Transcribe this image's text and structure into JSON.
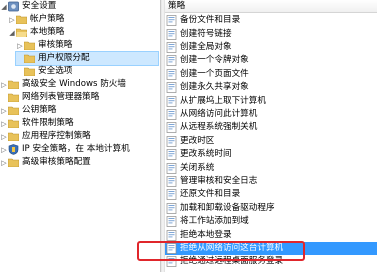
{
  "tree": {
    "items": [
      {
        "label": "安全设置",
        "arrow": "◢",
        "icon": "gear-icon"
      },
      {
        "label": "帐户策略",
        "arrow": "▷",
        "icon": "folder-icon"
      },
      {
        "label": "本地策略",
        "arrow": "◢",
        "icon": "folder-icon"
      },
      {
        "label": "审核策略",
        "arrow": "▷",
        "icon": "folder-icon"
      },
      {
        "label": "用户权限分配",
        "arrow": "",
        "icon": "folder-icon"
      },
      {
        "label": "安全选项",
        "arrow": "",
        "icon": "folder-icon"
      },
      {
        "label": "高级安全 Windows 防火墙",
        "arrow": "▷",
        "icon": "folder-icon"
      },
      {
        "label": "网络列表管理器策略",
        "arrow": "",
        "icon": "folder-icon"
      },
      {
        "label": "公钥策略",
        "arrow": "▷",
        "icon": "folder-icon"
      },
      {
        "label": "软件限制策略",
        "arrow": "▷",
        "icon": "folder-icon"
      },
      {
        "label": "应用程序控制策略",
        "arrow": "▷",
        "icon": "folder-icon"
      },
      {
        "label": "IP 安全策略，在 本地计算机",
        "arrow": "▷",
        "icon": "shield-icon"
      },
      {
        "label": "高级审核策略配置",
        "arrow": "▷",
        "icon": "folder-icon"
      }
    ]
  },
  "list": {
    "header": "策略",
    "items": [
      "备份文件和目录",
      "创建符号链接",
      "创建全局对象",
      "创建一个令牌对象",
      "创建一个页面文件",
      "创建永久共享对象",
      "从扩展坞上取下计算机",
      "从网络访问此计算机",
      "从远程系统强制关机",
      "更改时区",
      "更改系统时间",
      "关闭系统",
      "管理审核和安全日志",
      "还原文件和目录",
      "加载和卸载设备驱动程序",
      "将工作站添加到域",
      "拒绝本地登录",
      "拒绝从网络访问这台计算机",
      "拒绝通过远程桌面服务登录"
    ]
  },
  "colors": {
    "selection": "#3399ff",
    "tree_selection": "#cde8ff",
    "highlight": "#e0262b"
  }
}
